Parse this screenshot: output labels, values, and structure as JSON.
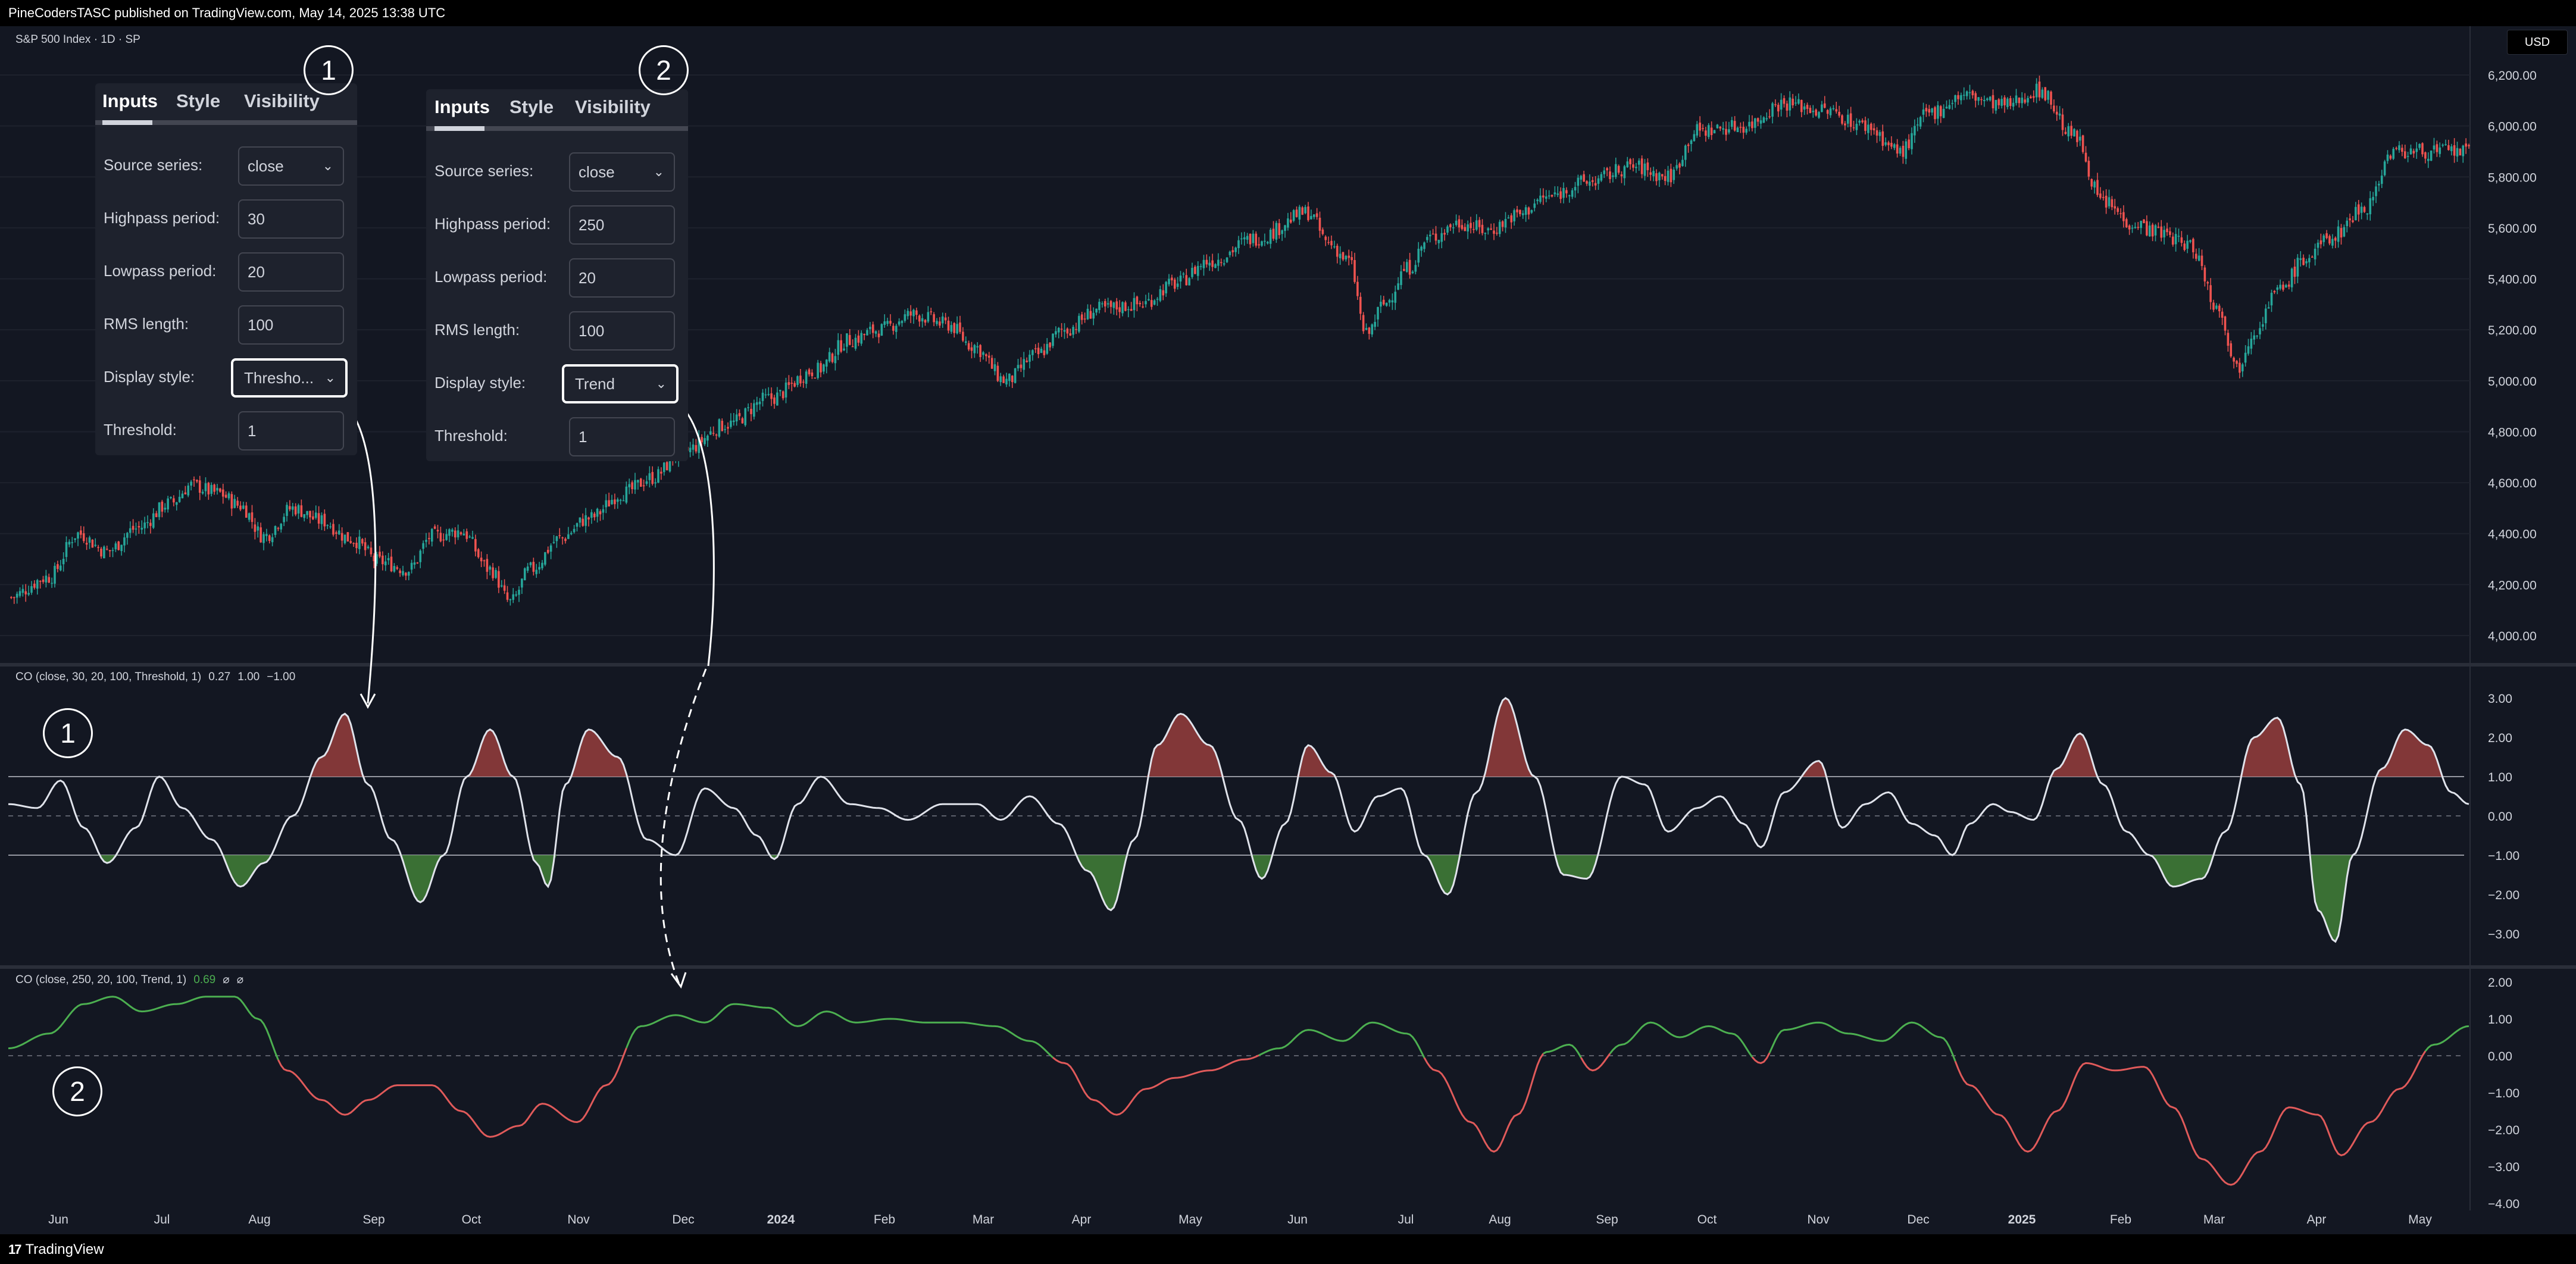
{
  "header": {
    "published": "PineCodersTASC published on TradingView.com, May 14, 2025 13:38 UTC"
  },
  "footer": {
    "brand": "TradingView",
    "brand_mark": "17"
  },
  "chart": {
    "symbol_title": "S&P 500 Index · 1D · SP",
    "currency": "USD",
    "price_axis": [
      "6,200.00",
      "6,000.00",
      "5,800.00",
      "5,600.00",
      "5,400.00",
      "5,200.00",
      "5,000.00",
      "4,800.00",
      "4,600.00",
      "4,400.00",
      "4,200.00",
      "4,000.00"
    ],
    "time_axis": [
      "Jun",
      "Jul",
      "Aug",
      "Sep",
      "Oct",
      "Nov",
      "Dec",
      "2024",
      "Feb",
      "Mar",
      "Apr",
      "May",
      "Jun",
      "Jul",
      "Aug",
      "Sep",
      "Oct",
      "Nov",
      "Dec",
      "2025",
      "Feb",
      "Mar",
      "Apr",
      "May"
    ],
    "bull_color": "#26a69a",
    "bear_color": "#ef5350",
    "price_shape": [
      [
        0,
        4150
      ],
      [
        14,
        4230
      ],
      [
        24,
        4400
      ],
      [
        34,
        4330
      ],
      [
        44,
        4420
      ],
      [
        56,
        4520
      ],
      [
        63,
        4590
      ],
      [
        72,
        4560
      ],
      [
        80,
        4510
      ],
      [
        88,
        4390
      ],
      [
        98,
        4500
      ],
      [
        108,
        4450
      ],
      [
        118,
        4380
      ],
      [
        128,
        4290
      ],
      [
        138,
        4260
      ],
      [
        146,
        4390
      ],
      [
        156,
        4410
      ],
      [
        166,
        4260
      ],
      [
        173,
        4130
      ],
      [
        180,
        4260
      ],
      [
        190,
        4380
      ],
      [
        200,
        4460
      ],
      [
        212,
        4560
      ],
      [
        222,
        4620
      ],
      [
        232,
        4720
      ],
      [
        248,
        4830
      ],
      [
        262,
        4930
      ],
      [
        278,
        5040
      ],
      [
        290,
        5160
      ],
      [
        300,
        5200
      ],
      [
        312,
        5260
      ],
      [
        324,
        5220
      ],
      [
        332,
        5140
      ],
      [
        344,
        5000
      ],
      [
        354,
        5100
      ],
      [
        364,
        5200
      ],
      [
        376,
        5280
      ],
      [
        390,
        5300
      ],
      [
        402,
        5380
      ],
      [
        414,
        5470
      ],
      [
        430,
        5560
      ],
      [
        448,
        5660
      ],
      [
        455,
        5540
      ],
      [
        462,
        5470
      ],
      [
        468,
        5180
      ],
      [
        474,
        5300
      ],
      [
        482,
        5440
      ],
      [
        490,
        5560
      ],
      [
        500,
        5620
      ],
      [
        510,
        5590
      ],
      [
        520,
        5650
      ],
      [
        530,
        5720
      ],
      [
        544,
        5780
      ],
      [
        560,
        5840
      ],
      [
        572,
        5800
      ],
      [
        582,
        5980
      ],
      [
        598,
        6000
      ],
      [
        612,
        6090
      ],
      [
        626,
        6060
      ],
      [
        640,
        6000
      ],
      [
        652,
        5900
      ],
      [
        662,
        6050
      ],
      [
        674,
        6120
      ],
      [
        688,
        6080
      ],
      [
        700,
        6140
      ],
      [
        712,
        5960
      ],
      [
        722,
        5700
      ],
      [
        732,
        5620
      ],
      [
        742,
        5580
      ],
      [
        752,
        5530
      ],
      [
        762,
        5280
      ],
      [
        768,
        5050
      ],
      [
        774,
        5200
      ],
      [
        782,
        5350
      ],
      [
        792,
        5480
      ],
      [
        800,
        5560
      ],
      [
        812,
        5680
      ],
      [
        822,
        5900
      ]
    ],
    "co1_label": "CO (close, 30, 20, 100, Threshold, 1)",
    "co1_values": [
      "0.27",
      "1.00",
      "−1.00"
    ],
    "co1_axis": [
      "3.00",
      "2.00",
      "1.00",
      "0.00",
      "−1.00",
      "−2.00",
      "−3.00"
    ],
    "co1_shape": [
      [
        0,
        0.3
      ],
      [
        10,
        0.2
      ],
      [
        18,
        0.9
      ],
      [
        26,
        -0.3
      ],
      [
        34,
        -1.2
      ],
      [
        44,
        -0.3
      ],
      [
        52,
        1.0
      ],
      [
        60,
        0.2
      ],
      [
        70,
        -0.6
      ],
      [
        80,
        -1.8
      ],
      [
        88,
        -1.2
      ],
      [
        98,
        0.0
      ],
      [
        108,
        1.5
      ],
      [
        116,
        2.6
      ],
      [
        124,
        0.8
      ],
      [
        132,
        -0.6
      ],
      [
        142,
        -2.2
      ],
      [
        150,
        -1.0
      ],
      [
        158,
        1.0
      ],
      [
        166,
        2.2
      ],
      [
        174,
        1.0
      ],
      [
        182,
        -1.2
      ],
      [
        186,
        -1.8
      ],
      [
        192,
        0.8
      ],
      [
        200,
        2.2
      ],
      [
        210,
        1.5
      ],
      [
        220,
        -0.6
      ],
      [
        230,
        -1.0
      ],
      [
        240,
        0.7
      ],
      [
        250,
        0.2
      ],
      [
        258,
        -0.5
      ],
      [
        264,
        -1.1
      ],
      [
        272,
        0.3
      ],
      [
        280,
        1.0
      ],
      [
        290,
        0.3
      ],
      [
        300,
        0.2
      ],
      [
        310,
        -0.1
      ],
      [
        322,
        0.3
      ],
      [
        334,
        0.3
      ],
      [
        342,
        -0.1
      ],
      [
        352,
        0.5
      ],
      [
        362,
        -0.2
      ],
      [
        372,
        -1.4
      ],
      [
        380,
        -2.4
      ],
      [
        388,
        -0.6
      ],
      [
        396,
        1.8
      ],
      [
        404,
        2.6
      ],
      [
        414,
        1.8
      ],
      [
        424,
        -0.1
      ],
      [
        432,
        -1.6
      ],
      [
        440,
        -0.2
      ],
      [
        448,
        1.8
      ],
      [
        456,
        1.1
      ],
      [
        464,
        -0.4
      ],
      [
        472,
        0.5
      ],
      [
        480,
        0.7
      ],
      [
        488,
        -1.0
      ],
      [
        496,
        -2.0
      ],
      [
        506,
        0.6
      ],
      [
        516,
        3.0
      ],
      [
        526,
        1.0
      ],
      [
        536,
        -1.5
      ],
      [
        544,
        -1.6
      ],
      [
        556,
        1.0
      ],
      [
        564,
        0.8
      ],
      [
        572,
        -0.4
      ],
      [
        582,
        0.2
      ],
      [
        590,
        0.5
      ],
      [
        598,
        -0.2
      ],
      [
        604,
        -0.8
      ],
      [
        612,
        0.6
      ],
      [
        624,
        1.4
      ],
      [
        632,
        -0.3
      ],
      [
        640,
        0.3
      ],
      [
        648,
        0.6
      ],
      [
        656,
        -0.2
      ],
      [
        664,
        -0.5
      ],
      [
        670,
        -1.0
      ],
      [
        676,
        -0.2
      ],
      [
        684,
        0.3
      ],
      [
        690,
        0.1
      ],
      [
        698,
        -0.1
      ],
      [
        706,
        1.2
      ],
      [
        714,
        2.1
      ],
      [
        722,
        0.8
      ],
      [
        730,
        -0.4
      ],
      [
        738,
        -1.0
      ],
      [
        746,
        -1.8
      ],
      [
        756,
        -1.6
      ],
      [
        764,
        -0.4
      ],
      [
        774,
        2.0
      ],
      [
        782,
        2.5
      ],
      [
        790,
        0.8
      ],
      [
        796,
        -2.4
      ],
      [
        802,
        -3.2
      ],
      [
        808,
        -1.0
      ],
      [
        818,
        1.2
      ],
      [
        826,
        2.2
      ],
      [
        834,
        1.8
      ],
      [
        842,
        0.6
      ],
      [
        848,
        0.3
      ]
    ],
    "co2_label": "CO (close, 250, 20, 100, Trend, 1)",
    "co2_value": "0.69",
    "co2_value_color": "#4caf50",
    "co2_extras": [
      "⌀",
      "⌀"
    ],
    "co2_axis": [
      "2.00",
      "1.00",
      "0.00",
      "−1.00",
      "−2.00",
      "−3.00",
      "−4.00"
    ],
    "co2_shape": [
      [
        0,
        0.2
      ],
      [
        14,
        0.6
      ],
      [
        26,
        1.4
      ],
      [
        36,
        1.6
      ],
      [
        46,
        1.2
      ],
      [
        58,
        1.4
      ],
      [
        68,
        1.6
      ],
      [
        78,
        1.6
      ],
      [
        86,
        1.0
      ],
      [
        96,
        -0.4
      ],
      [
        108,
        -1.2
      ],
      [
        116,
        -1.6
      ],
      [
        124,
        -1.2
      ],
      [
        134,
        -0.8
      ],
      [
        146,
        -0.8
      ],
      [
        156,
        -1.5
      ],
      [
        166,
        -2.2
      ],
      [
        176,
        -1.9
      ],
      [
        184,
        -1.3
      ],
      [
        196,
        -1.8
      ],
      [
        206,
        -0.8
      ],
      [
        218,
        0.8
      ],
      [
        230,
        1.1
      ],
      [
        240,
        0.9
      ],
      [
        250,
        1.4
      ],
      [
        262,
        1.3
      ],
      [
        272,
        0.8
      ],
      [
        282,
        1.2
      ],
      [
        292,
        0.9
      ],
      [
        304,
        1.0
      ],
      [
        316,
        0.9
      ],
      [
        328,
        0.9
      ],
      [
        340,
        0.8
      ],
      [
        352,
        0.4
      ],
      [
        364,
        -0.2
      ],
      [
        374,
        -1.2
      ],
      [
        382,
        -1.6
      ],
      [
        392,
        -0.9
      ],
      [
        402,
        -0.6
      ],
      [
        414,
        -0.4
      ],
      [
        426,
        -0.1
      ],
      [
        438,
        0.2
      ],
      [
        448,
        0.7
      ],
      [
        460,
        0.4
      ],
      [
        470,
        0.9
      ],
      [
        482,
        0.6
      ],
      [
        492,
        -0.4
      ],
      [
        504,
        -1.8
      ],
      [
        512,
        -2.6
      ],
      [
        520,
        -1.6
      ],
      [
        530,
        0.1
      ],
      [
        538,
        0.3
      ],
      [
        546,
        -0.4
      ],
      [
        556,
        0.3
      ],
      [
        566,
        0.9
      ],
      [
        576,
        0.5
      ],
      [
        586,
        0.8
      ],
      [
        594,
        0.6
      ],
      [
        604,
        -0.2
      ],
      [
        612,
        0.7
      ],
      [
        624,
        0.9
      ],
      [
        634,
        0.6
      ],
      [
        646,
        0.4
      ],
      [
        656,
        0.9
      ],
      [
        666,
        0.5
      ],
      [
        676,
        -0.8
      ],
      [
        686,
        -1.6
      ],
      [
        696,
        -2.6
      ],
      [
        706,
        -1.5
      ],
      [
        716,
        -0.2
      ],
      [
        726,
        -0.4
      ],
      [
        736,
        -0.3
      ],
      [
        746,
        -1.4
      ],
      [
        756,
        -2.8
      ],
      [
        766,
        -3.5
      ],
      [
        776,
        -2.6
      ],
      [
        786,
        -1.4
      ],
      [
        796,
        -1.6
      ],
      [
        804,
        -2.7
      ],
      [
        814,
        -1.8
      ],
      [
        824,
        -0.9
      ],
      [
        836,
        0.3
      ],
      [
        848,
        0.8
      ]
    ]
  },
  "panel1": {
    "tabs": [
      "Inputs",
      "Style",
      "Visibility"
    ],
    "rows": [
      {
        "label": "Source series:",
        "value": "close",
        "type": "select"
      },
      {
        "label": "Highpass period:",
        "value": "30",
        "type": "input"
      },
      {
        "label": "Lowpass period:",
        "value": "20",
        "type": "input"
      },
      {
        "label": "RMS length:",
        "value": "100",
        "type": "input"
      },
      {
        "label": "Display style:",
        "value": "Thresho...",
        "type": "select"
      },
      {
        "label": "Threshold:",
        "value": "1",
        "type": "input"
      }
    ]
  },
  "panel2": {
    "tabs": [
      "Inputs",
      "Style",
      "Visibility"
    ],
    "rows": [
      {
        "label": "Source series:",
        "value": "close",
        "type": "select"
      },
      {
        "label": "Highpass period:",
        "value": "250",
        "type": "input"
      },
      {
        "label": "Lowpass period:",
        "value": "20",
        "type": "input"
      },
      {
        "label": "RMS length:",
        "value": "100",
        "type": "input"
      },
      {
        "label": "Display style:",
        "value": "Trend",
        "type": "select"
      },
      {
        "label": "Threshold:",
        "value": "1",
        "type": "input"
      }
    ]
  },
  "badges": {
    "one": "1",
    "two": "2"
  }
}
